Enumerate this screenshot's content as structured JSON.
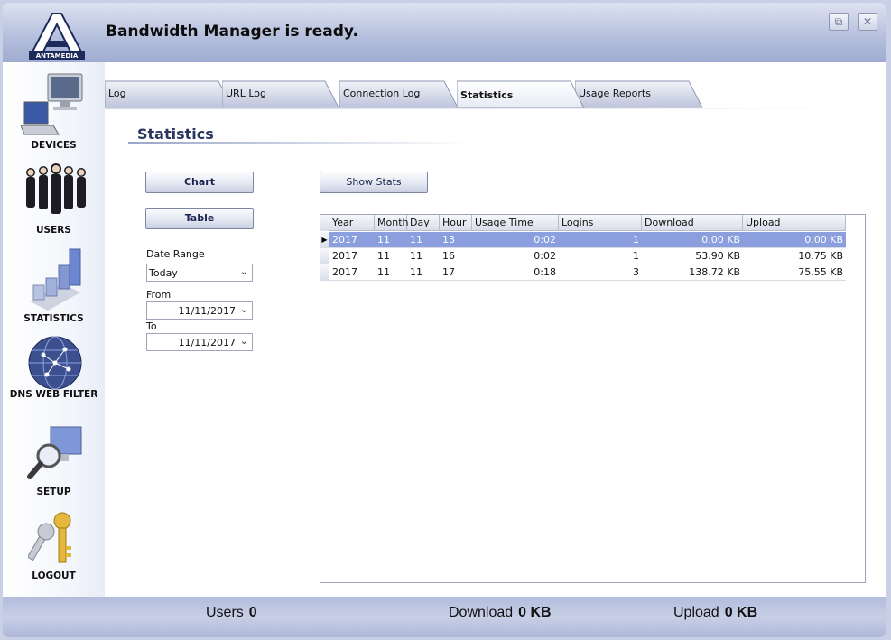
{
  "header": {
    "logo_text": "ANTAMEDIA",
    "status": "Bandwidth Manager is ready."
  },
  "sidebar": {
    "items": [
      {
        "label": "DEVICES"
      },
      {
        "label": "USERS"
      },
      {
        "label": "STATISTICS"
      },
      {
        "label": "DNS WEB FILTER"
      },
      {
        "label": "SETUP"
      },
      {
        "label": "LOGOUT"
      }
    ]
  },
  "tabs": [
    {
      "label": "Log"
    },
    {
      "label": "URL Log"
    },
    {
      "label": "Connection Log"
    },
    {
      "label": "Statistics"
    },
    {
      "label": "Usage Reports"
    }
  ],
  "page": {
    "title": "Statistics",
    "chart_button": "Chart",
    "table_button": "Table",
    "show_stats_button": "Show Stats",
    "date_range_label": "Date Range",
    "date_range_value": "Today",
    "from_label": "From",
    "from_value": "11/11/2017",
    "to_label": "To",
    "to_value": "11/11/2017"
  },
  "grid": {
    "columns": [
      "Year",
      "Month",
      "Day",
      "Hour",
      "Usage Time",
      "Logins",
      "Download",
      "Upload"
    ],
    "rows": [
      [
        "2017",
        "11",
        "11",
        "13",
        "0:02",
        "1",
        "0.00 KB",
        "0.00 KB"
      ],
      [
        "2017",
        "11",
        "11",
        "16",
        "0:02",
        "1",
        "53.90 KB",
        "10.75 KB"
      ],
      [
        "2017",
        "11",
        "11",
        "17",
        "0:18",
        "3",
        "138.72 KB",
        "75.55 KB"
      ]
    ]
  },
  "footer": {
    "users_label": "Users",
    "users_value": "0",
    "download_label": "Download",
    "download_value": "0 KB",
    "upload_label": "Upload",
    "upload_value": "0 KB"
  },
  "colors": {
    "selected_row": "#8b9ede",
    "header_band": "#b4bedc",
    "title": "#2a3560"
  }
}
